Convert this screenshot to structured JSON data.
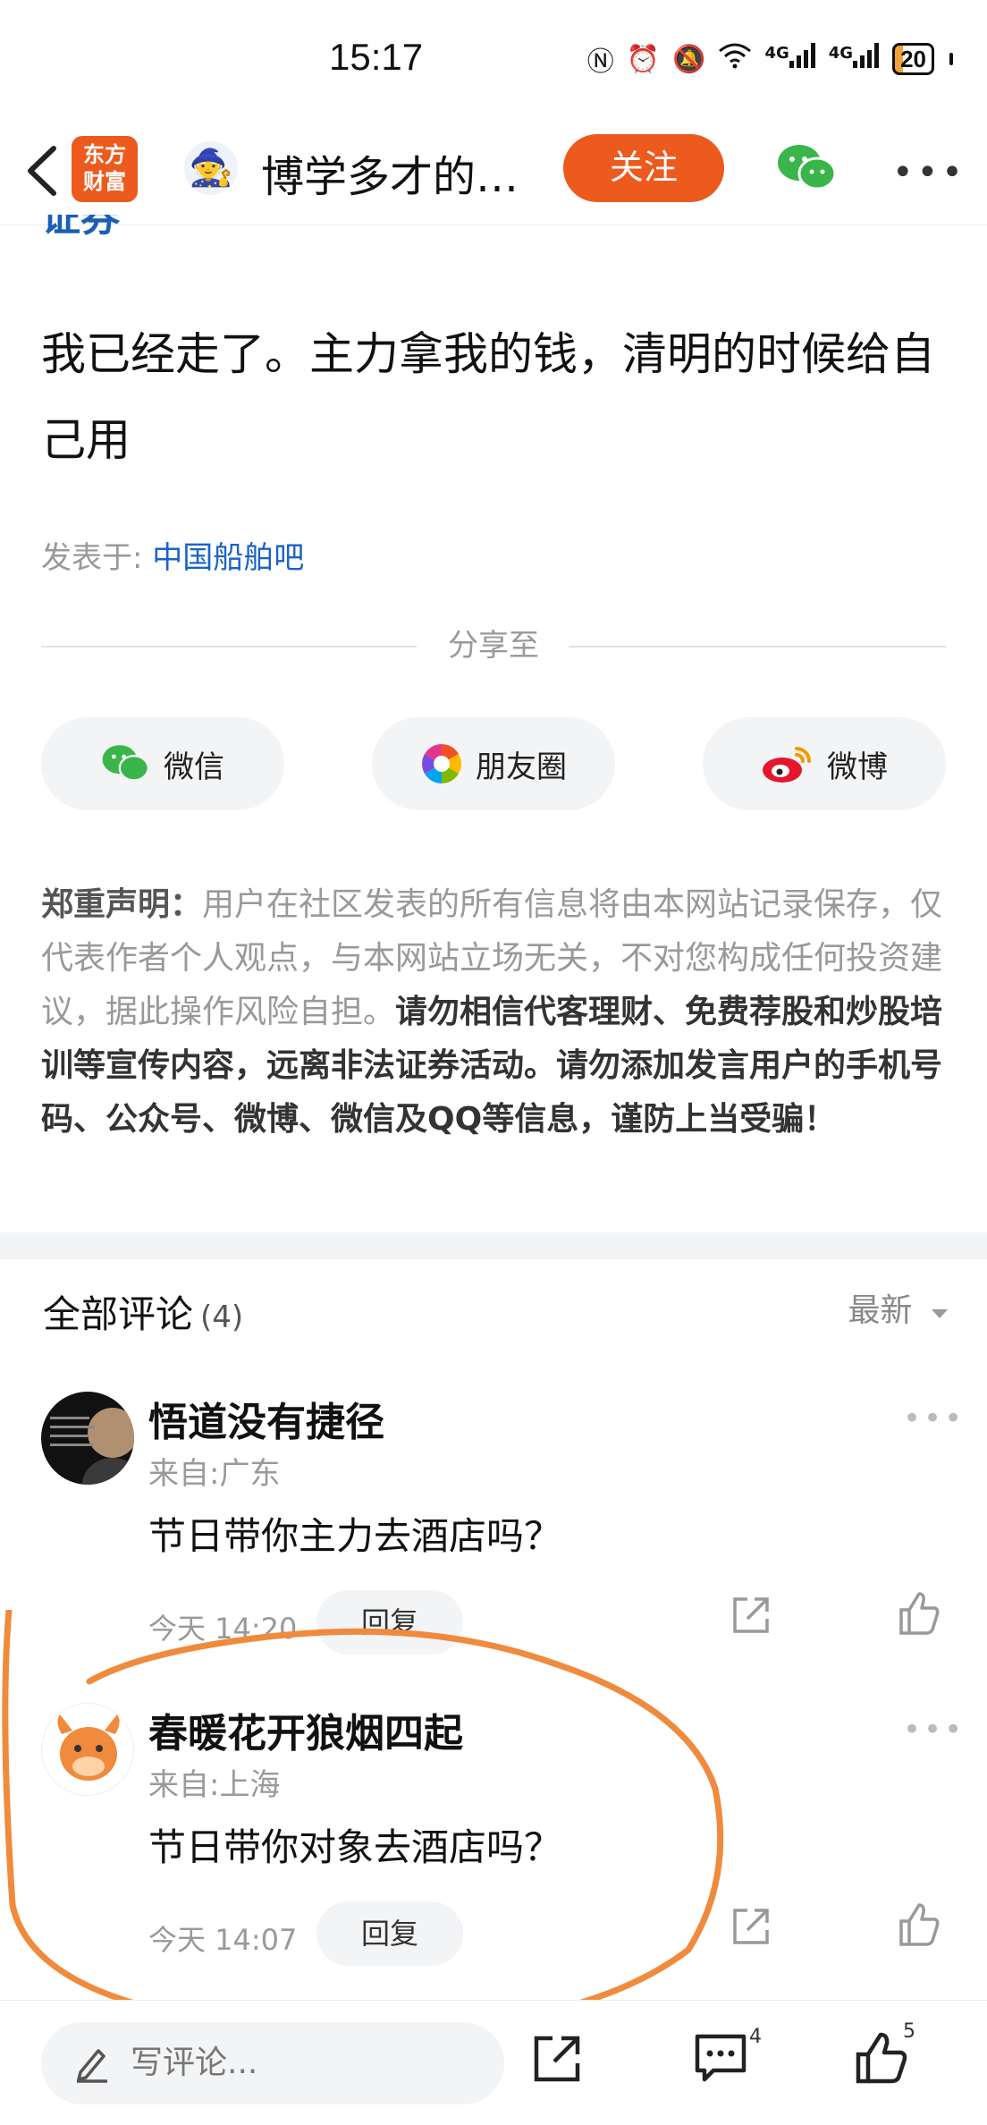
{
  "status_bar": {
    "time": "15:17",
    "battery": "20",
    "net1": "4G",
    "net2": "4G"
  },
  "header": {
    "logo_line1": "东方",
    "logo_line2": "财富",
    "author": "博学多才的…",
    "follow_label": "关注"
  },
  "post": {
    "cut_text": "证券",
    "body": "我已经走了。主力拿我的钱，清明的时候给自己用",
    "posted_prefix": "发表于: ",
    "posted_bar": "中国船舶吧"
  },
  "share": {
    "label": "分享至",
    "buttons": [
      {
        "label": "微信",
        "icon": "wechat-icon"
      },
      {
        "label": "朋友圈",
        "icon": "moments-icon"
      },
      {
        "label": "微博",
        "icon": "weibo-icon"
      }
    ]
  },
  "disclaimer": {
    "title": "郑重声明",
    "colon": "：",
    "normal": "用户在社区发表的所有信息将由本网站记录保存，仅代表作者个人观点，与本网站立场无关，不对您构成任何投资建议，据此操作风险自担。",
    "bold": "请勿相信代客理财、免费荐股和炒股培训等宣传内容，远离非法证券活动。请勿添加发言用户的手机号码、公众号、微博、微信及QQ等信息，谨防上当受骗！"
  },
  "comments": {
    "title": "全部评论",
    "count": "(4)",
    "sort_label": "最新",
    "items": [
      {
        "name": "悟道没有捷径",
        "from": "来自:广东",
        "text": "节日带你主力去酒店吗？",
        "time": "今天 14:20",
        "reply": "回复"
      },
      {
        "name": "春暖花开狼烟四起",
        "from": "来自:上海",
        "text": "节日带你对象去酒店吗？",
        "time": "今天 14:07",
        "reply": "回复"
      }
    ]
  },
  "bottom": {
    "write_placeholder": "写评论...",
    "comment_count": "4",
    "like_count": "5"
  },
  "colors": {
    "accent": "#ec5a1e",
    "link": "#1a62c8",
    "annotation": "#f08a3c"
  }
}
